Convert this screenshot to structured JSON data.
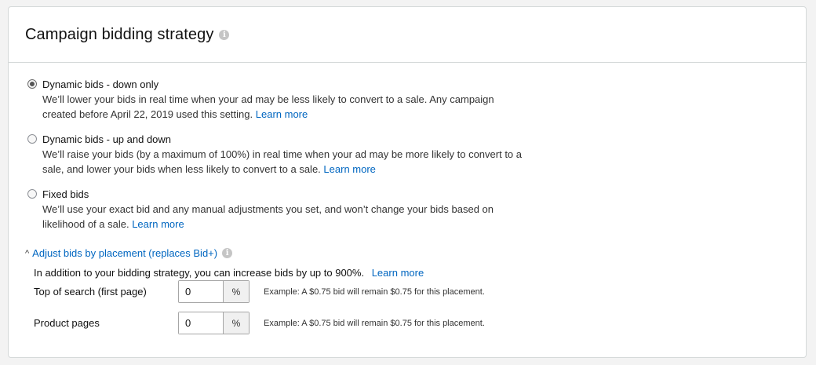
{
  "header": {
    "title": "Campaign bidding strategy",
    "info_icon": "i"
  },
  "strategies": [
    {
      "label": "Dynamic bids - down only",
      "description": "We’ll lower your bids in real time when your ad may be less likely to convert to a sale. Any campaign created before April 22, 2019 used this setting.",
      "link": "Learn more",
      "selected": true
    },
    {
      "label": "Dynamic bids - up and down",
      "description": "We’ll raise your bids (by a maximum of 100%) in real time when your ad may be more likely to convert to a sale, and lower your bids when less likely to convert to a sale.",
      "link": "Learn more",
      "selected": false
    },
    {
      "label": "Fixed bids",
      "description": "We’ll use your exact bid and any manual adjustments you set, and won’t change your bids based on likelihood of a sale.",
      "link": "Learn more",
      "selected": false
    }
  ],
  "adjust": {
    "toggle_label": "Adjust bids by placement (replaces Bid+)",
    "caret": "^",
    "info_icon": "i",
    "description": "In addition to your bidding strategy, you can increase bids by up to 900%.",
    "link": "Learn more",
    "rows": [
      {
        "label": "Top of search (first page)",
        "value": "0",
        "suffix": "%",
        "example": "Example: A $0.75 bid will remain $0.75 for this placement."
      },
      {
        "label": "Product pages",
        "value": "0",
        "suffix": "%",
        "example": "Example: A $0.75 bid will remain $0.75 for this placement."
      }
    ]
  },
  "colors": {
    "link": "#0066c0",
    "border": "#d5d9d9"
  }
}
